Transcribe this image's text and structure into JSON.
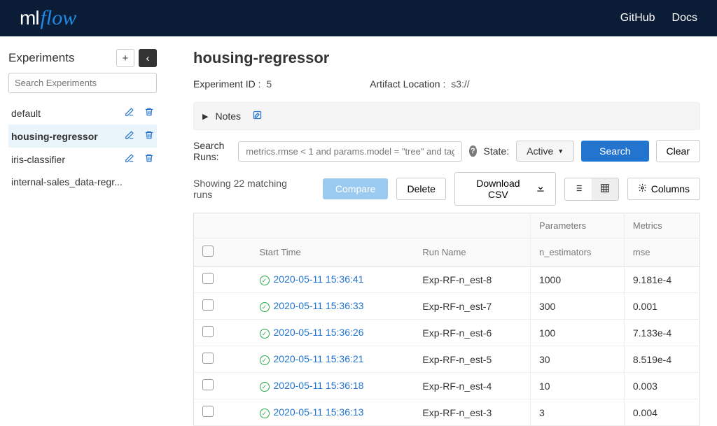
{
  "header": {
    "nav": [
      {
        "label": "GitHub"
      },
      {
        "label": "Docs"
      }
    ]
  },
  "sidebar": {
    "title": "Experiments",
    "search_placeholder": "Search Experiments",
    "items": [
      {
        "name": "default",
        "selected": false
      },
      {
        "name": "housing-regressor",
        "selected": true
      },
      {
        "name": "iris-classifier",
        "selected": false
      },
      {
        "name": "internal-sales_data-regr...",
        "selected": false
      }
    ]
  },
  "experiment": {
    "title": "housing-regressor",
    "id_label": "Experiment ID :",
    "id_value": "5",
    "artifact_label": "Artifact Location :",
    "artifact_value": "s3://"
  },
  "notes": {
    "label": "Notes"
  },
  "search": {
    "label": "Search Runs:",
    "placeholder": "metrics.rmse < 1 and params.model = \"tree\" and tags",
    "state_label": "State:",
    "state_value": "Active",
    "search_btn": "Search",
    "clear_btn": "Clear"
  },
  "actions": {
    "showing": "Showing 22 matching runs",
    "compare": "Compare",
    "delete": "Delete",
    "download": "Download CSV",
    "columns": "Columns"
  },
  "table": {
    "group_headers": {
      "params": "Parameters",
      "metrics": "Metrics"
    },
    "columns": {
      "start_time": "Start Time",
      "run_name": "Run Name",
      "n_estimators": "n_estimators",
      "mse": "mse"
    },
    "rows": [
      {
        "start_time": "2020-05-11 15:36:41",
        "run_name": "Exp-RF-n_est-8",
        "n_estimators": "1000",
        "mse": "9.181e-4"
      },
      {
        "start_time": "2020-05-11 15:36:33",
        "run_name": "Exp-RF-n_est-7",
        "n_estimators": "300",
        "mse": "0.001"
      },
      {
        "start_time": "2020-05-11 15:36:26",
        "run_name": "Exp-RF-n_est-6",
        "n_estimators": "100",
        "mse": "7.133e-4"
      },
      {
        "start_time": "2020-05-11 15:36:21",
        "run_name": "Exp-RF-n_est-5",
        "n_estimators": "30",
        "mse": "8.519e-4"
      },
      {
        "start_time": "2020-05-11 15:36:18",
        "run_name": "Exp-RF-n_est-4",
        "n_estimators": "10",
        "mse": "0.003"
      },
      {
        "start_time": "2020-05-11 15:36:13",
        "run_name": "Exp-RF-n_est-3",
        "n_estimators": "3",
        "mse": "0.004"
      }
    ]
  }
}
